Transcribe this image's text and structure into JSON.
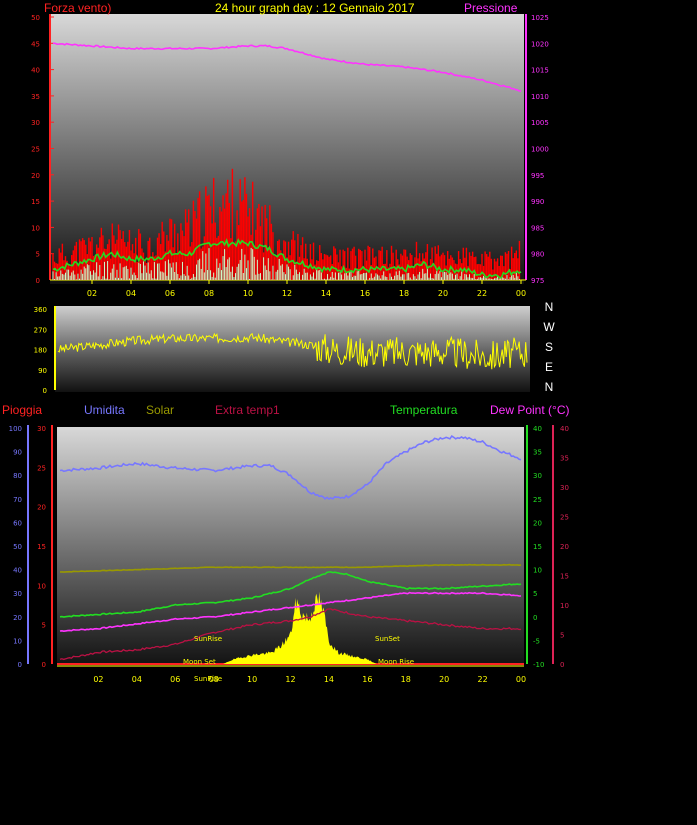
{
  "header": {
    "wind_label": "Forza vento)",
    "title": "24 hour graph day : 12 Gennaio 2017",
    "pressure_label": "Pressione"
  },
  "legend2": {
    "rain": "Pioggia",
    "humidity": "Umidita",
    "solar": "Solar",
    "extra": "Extra temp1",
    "temperature": "Temperatura",
    "dew": "Dew Point (°C)"
  },
  "compass": [
    "N",
    "W",
    "S",
    "E",
    "N"
  ],
  "annotations": {
    "sunrise": "SunRise",
    "sunset": "SunSet",
    "moonset": "Moon Set",
    "moonrise": "Moon Rise",
    "sunrise_low": "SunRise"
  },
  "colors": {
    "wind": "#ff0000",
    "gust_avg": "#22dd22",
    "pressure": "#ff33ff",
    "direction": "#ffff00",
    "humidity": "#7777ff",
    "solar": "#ffff00",
    "solar_line": "#999900",
    "extra": "#bb1144",
    "temperature": "#22dd22",
    "dew": "#ff33ff"
  },
  "chart_data": [
    {
      "type": "line",
      "x_ticks": [
        "02",
        "04",
        "06",
        "08",
        "10",
        "12",
        "14",
        "16",
        "18",
        "20",
        "22",
        "00"
      ],
      "left_axis": {
        "ticks": [
          0,
          5,
          10,
          15,
          20,
          25,
          30,
          35,
          40,
          45,
          50
        ],
        "ylim": [
          0,
          50
        ]
      },
      "right_axis": {
        "ticks": [
          975,
          980,
          985,
          990,
          995,
          1000,
          1005,
          1010,
          1015,
          1020,
          1025
        ],
        "ylim": [
          975,
          1025
        ]
      },
      "series": [
        {
          "key": "pressure",
          "hours": [
            0,
            2,
            4,
            6,
            8,
            10,
            11,
            12,
            13,
            14,
            15,
            16,
            18,
            20,
            22,
            24
          ],
          "values": [
            1020,
            1019.5,
            1019,
            1019,
            1019,
            1019.5,
            1019.5,
            1019,
            1018,
            1017,
            1016.5,
            1016,
            1015.5,
            1014.5,
            1013,
            1011
          ]
        },
        {
          "key": "gust_avg",
          "hours": [
            0,
            1,
            2,
            3,
            4,
            5,
            6,
            7,
            8,
            9,
            10,
            11,
            12,
            13,
            14,
            15,
            16,
            17,
            18,
            19,
            20,
            21,
            22,
            23,
            24
          ],
          "values": [
            2,
            3,
            4,
            5,
            4,
            4,
            5,
            5,
            7,
            7,
            7,
            6,
            4,
            3,
            2,
            2,
            2,
            2,
            2,
            3,
            2,
            2,
            1,
            1,
            2
          ]
        },
        {
          "key": "wind_gust_envelope",
          "hours": [
            0,
            1,
            2,
            3,
            4,
            5,
            6,
            7,
            8,
            9,
            10,
            11,
            12,
            13,
            14,
            15,
            16,
            17,
            18,
            19,
            20,
            21,
            22,
            23,
            24
          ],
          "values": [
            6,
            7,
            9,
            10,
            9,
            9,
            12,
            13,
            18,
            20,
            18,
            14,
            10,
            7,
            6,
            6,
            6,
            6,
            6,
            7,
            6,
            6,
            5,
            5,
            7
          ]
        }
      ]
    },
    {
      "type": "line",
      "x_ticks": [],
      "left_axis": {
        "ticks": [
          0,
          90,
          180,
          270,
          360
        ],
        "ylim": [
          0,
          360
        ]
      },
      "series": [
        {
          "key": "direction",
          "hours": [
            0,
            2,
            4,
            6,
            8,
            10,
            12,
            13,
            14,
            16,
            18,
            20,
            22,
            24
          ],
          "values": [
            180,
            200,
            220,
            230,
            230,
            235,
            210,
            200,
            180,
            170,
            170,
            170,
            150,
            170
          ]
        }
      ]
    },
    {
      "type": "line",
      "x_ticks": [
        "02",
        "04",
        "06",
        "08",
        "10",
        "12",
        "14",
        "16",
        "18",
        "20",
        "22",
        "00"
      ],
      "axes": {
        "humidity": {
          "ticks": [
            0,
            10,
            20,
            30,
            40,
            50,
            60,
            70,
            80,
            90,
            100
          ],
          "ylim": [
            0,
            100
          ]
        },
        "rain": {
          "ticks": [
            0,
            5,
            10,
            15,
            20,
            25,
            30
          ],
          "ylim": [
            0,
            30
          ]
        },
        "temperature": {
          "ticks": [
            -10,
            -5,
            0,
            5,
            10,
            15,
            20,
            25,
            30,
            35,
            40
          ],
          "ylim": [
            -10,
            40
          ]
        },
        "dew": {
          "ticks": [
            0,
            5,
            10,
            15,
            20,
            25,
            30,
            35,
            40
          ],
          "ylim": [
            0,
            40
          ]
        }
      },
      "series": [
        {
          "key": "humidity",
          "axis": "humidity",
          "hours": [
            0,
            2,
            4,
            6,
            8,
            10,
            11,
            12,
            13,
            14,
            15,
            16,
            17,
            18,
            19,
            20,
            21,
            22,
            23,
            24
          ],
          "values": [
            82,
            83,
            85,
            83,
            82,
            84,
            84,
            80,
            73,
            70,
            71,
            76,
            85,
            90,
            94,
            96,
            96,
            94,
            90,
            87
          ]
        },
        {
          "key": "solar_line",
          "axis": "humidity",
          "hours": [
            0,
            4,
            8,
            12,
            16,
            20,
            24
          ],
          "values": [
            39,
            40,
            41,
            41,
            41,
            42,
            42
          ]
        },
        {
          "key": "temperature",
          "axis": "temperature",
          "hours": [
            0,
            2,
            4,
            6,
            8,
            10,
            12,
            13,
            14,
            15,
            16,
            18,
            20,
            22,
            24
          ],
          "values": [
            0,
            0.5,
            1,
            2.5,
            3,
            4,
            6,
            8,
            9.5,
            9,
            7.5,
            6,
            6,
            6.5,
            7
          ]
        },
        {
          "key": "dew",
          "axis": "temperature",
          "hours": [
            0,
            2,
            4,
            6,
            8,
            10,
            12,
            14,
            16,
            18,
            20,
            22,
            24
          ],
          "values": [
            -3,
            -2.5,
            -1.5,
            -0.5,
            0,
            1,
            2,
            3,
            4,
            5,
            5,
            5,
            4.5
          ]
        },
        {
          "key": "extra",
          "axis": "rain",
          "hours": [
            0,
            1,
            2,
            4,
            6,
            8,
            10,
            12,
            13,
            14,
            16,
            18,
            20,
            22,
            24
          ],
          "values": [
            0.6,
            1,
            1.5,
            1.8,
            2.5,
            4,
            5,
            5.5,
            6,
            7,
            6,
            5.5,
            5,
            4.5,
            4.5
          ]
        },
        {
          "key": "solar",
          "axis": "humidity",
          "hours": [
            8.5,
            9,
            10,
            11,
            11.5,
            12,
            12.3,
            12.6,
            13,
            13.2,
            13.5,
            13.8,
            14,
            14.5,
            15,
            15.5,
            16,
            16.5
          ],
          "values": [
            0,
            2,
            4,
            5,
            8,
            13,
            28,
            22,
            20,
            26,
            29,
            20,
            10,
            5,
            4,
            3,
            2,
            0
          ]
        }
      ]
    }
  ]
}
